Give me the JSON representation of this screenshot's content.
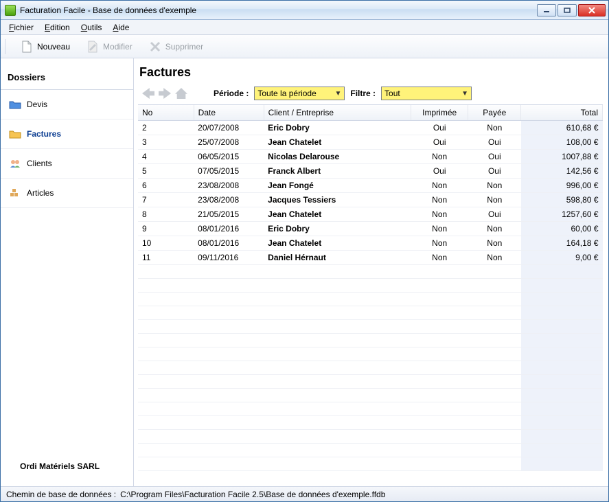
{
  "window": {
    "title": "Facturation Facile - Base de données d'exemple"
  },
  "menubar": {
    "items": [
      {
        "label": "Fichier",
        "hotkey_index": 0
      },
      {
        "label": "Edition",
        "hotkey_index": 0
      },
      {
        "label": "Outils",
        "hotkey_index": 0
      },
      {
        "label": "Aide",
        "hotkey_index": 0
      }
    ]
  },
  "toolbar": {
    "nouveau_label": "Nouveau",
    "modifier_label": "Modifier",
    "supprimer_label": "Supprimer",
    "modifier_enabled": false,
    "supprimer_enabled": false
  },
  "sidebar": {
    "title": "Dossiers",
    "items": [
      {
        "label": "Devis",
        "icon": "folder-blue",
        "active": false
      },
      {
        "label": "Factures",
        "icon": "folder-yellow",
        "active": true
      },
      {
        "label": "Clients",
        "icon": "clients",
        "active": false
      },
      {
        "label": "Articles",
        "icon": "articles",
        "active": false
      }
    ],
    "footer": "Ordi Matériels SARL"
  },
  "content": {
    "heading": "Factures",
    "filters": {
      "periode_label": "Période :",
      "periode_value": "Toute la période",
      "filtre_label": "Filtre :",
      "filtre_value": "Tout"
    },
    "columns": {
      "no": "No",
      "date": "Date",
      "client": "Client / Entreprise",
      "imprimee": "Imprimée",
      "payee": "Payée",
      "total": "Total"
    },
    "rows": [
      {
        "no": "2",
        "date": "20/07/2008",
        "client": "Eric Dobry",
        "imprimee": "Oui",
        "payee": "Non",
        "total": "610,68 €"
      },
      {
        "no": "3",
        "date": "25/07/2008",
        "client": "Jean Chatelet",
        "imprimee": "Oui",
        "payee": "Oui",
        "total": "108,00 €"
      },
      {
        "no": "4",
        "date": "06/05/2015",
        "client": "Nicolas Delarouse",
        "imprimee": "Non",
        "payee": "Oui",
        "total": "1007,88 €"
      },
      {
        "no": "5",
        "date": "07/05/2015",
        "client": "Franck Albert",
        "imprimee": "Oui",
        "payee": "Oui",
        "total": "142,56 €"
      },
      {
        "no": "6",
        "date": "23/08/2008",
        "client": "Jean Fongé",
        "imprimee": "Non",
        "payee": "Non",
        "total": "996,00 €"
      },
      {
        "no": "7",
        "date": "23/08/2008",
        "client": "Jacques Tessiers",
        "imprimee": "Non",
        "payee": "Non",
        "total": "598,80 €"
      },
      {
        "no": "8",
        "date": "21/05/2015",
        "client": "Jean Chatelet",
        "imprimee": "Non",
        "payee": "Oui",
        "total": "1257,60 €"
      },
      {
        "no": "9",
        "date": "08/01/2016",
        "client": "Eric Dobry",
        "imprimee": "Non",
        "payee": "Non",
        "total": "60,00 €"
      },
      {
        "no": "10",
        "date": "08/01/2016",
        "client": "Jean Chatelet",
        "imprimee": "Non",
        "payee": "Non",
        "total": "164,18 €"
      },
      {
        "no": "11",
        "date": "09/11/2016",
        "client": "Daniel Hérnaut",
        "imprimee": "Non",
        "payee": "Non",
        "total": "9,00 €"
      }
    ]
  },
  "statusbar": {
    "label": "Chemin de base de données :",
    "value": "C:\\Program Files\\Facturation Facile 2.5\\Base de données d'exemple.ffdb"
  }
}
